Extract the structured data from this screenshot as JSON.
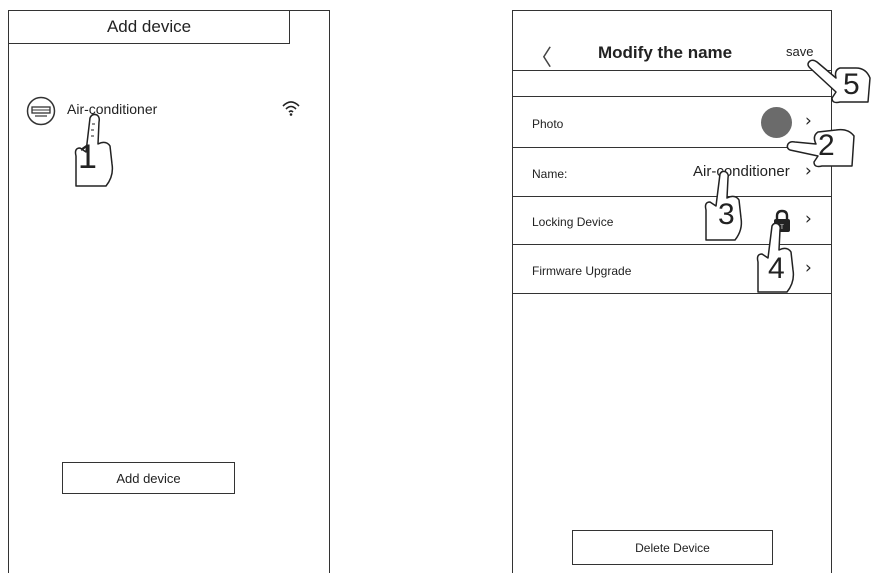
{
  "left_screen": {
    "title": "Add device",
    "device": {
      "label": "Air-conditioner",
      "icon": "ac-unit-icon",
      "status_icon": "wifi-icon"
    },
    "add_button": "Add device",
    "step": "1"
  },
  "right_screen": {
    "header": {
      "back_icon": "chevron-left-icon",
      "title": "Modify the name",
      "save": "save"
    },
    "rows": [
      {
        "label": "Photo",
        "value": "",
        "icon": "avatar-circle-icon",
        "step": "2"
      },
      {
        "label": "Name:",
        "value": "Air-conditioner",
        "step": "3"
      },
      {
        "label": "Locking Device",
        "value": "",
        "icon": "lock-icon",
        "step": "4"
      },
      {
        "label": "Firmware Upgrade",
        "value": ""
      }
    ],
    "save_step": "5",
    "delete_button": "Delete Device"
  },
  "colors": {
    "line": "#333333",
    "avatar": "#6b6b6b",
    "lock": "#222222"
  }
}
